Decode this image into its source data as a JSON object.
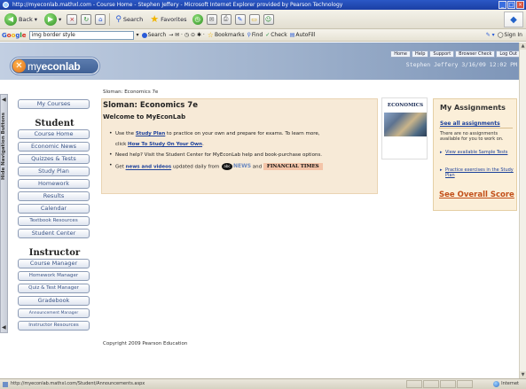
{
  "window": {
    "title": "http://myeconlab.mathxl.com - Course Home - Stephen Jeffery - Microsoft Internet Explorer provided by Pearson Technology"
  },
  "navbar": {
    "back_label": "Back",
    "search_label": "Search",
    "favorites_label": "Favorites"
  },
  "googlebar": {
    "logo": "Google",
    "search_value": "img border style",
    "search_label": "Search",
    "bookmarks_label": "Bookmarks",
    "find_label": "Find",
    "check_label": "Check",
    "autofill_label": "AutoFill",
    "signin_label": "Sign In"
  },
  "header": {
    "logo_my": "my",
    "logo_econlab": "econlab",
    "links": [
      "Home",
      "Help",
      "Support",
      "Browser Check",
      "Log Out"
    ],
    "user_line": "Stephen Jeffery 3/16/09 12:02 PM"
  },
  "hide_nav": {
    "label": "Hide Navigation Buttons"
  },
  "sidebar": {
    "my_courses": "My Courses",
    "student_heading": "Student",
    "student_items": [
      "Course Home",
      "Economic News",
      "Quizzes & Tests",
      "Study Plan",
      "Homework",
      "Results",
      "Calendar",
      "Textbook Resources",
      "Student Center"
    ],
    "instructor_heading": "Instructor",
    "instructor_items": [
      "Course Manager",
      "Homework Manager",
      "Quiz & Test Manager",
      "Gradebook",
      "Announcement Manager",
      "Instructor Resources"
    ]
  },
  "main": {
    "breadcrumb": "Sloman: Economics 7e",
    "course_title": "Sloman: Economics 7e",
    "welcome": "Welcome to MyEconLab",
    "line1_pre": "Use the ",
    "line1_link": "Study Plan",
    "line1_post": " to practice on your own and prepare for exams. To learn more,",
    "line1b_pre": "click ",
    "line1b_link": "How To Study On Your Own",
    "line1b_post": ".",
    "line2": "Need help? Visit the Student Center for MyEconLab help and book-purchase options.",
    "line3_pre": "Get ",
    "line3_link": "news and videos",
    "line3_mid": " updated daily from ",
    "abc_logo": "abc",
    "news_text": "NEWS",
    "line3_and": " and ",
    "ft_label": "FINANCIAL TIMES",
    "copyright": "Copyright 2009 Pearson Education"
  },
  "book": {
    "title": "ECONOMICS"
  },
  "assignments": {
    "title": "My Assignments",
    "see_all": "See all assignments",
    "none_text": "There are no assignments available for you to work on.",
    "link_samples": "View available Sample Tests",
    "link_studyplan": "Practice exercises in the Study Plan",
    "overall_score": "See Overall Score"
  },
  "statusbar": {
    "url": "http://myeconlab.mathxl.com/Student/Announcements.aspx",
    "zone": "Internet"
  },
  "colors": {
    "header_gradient_start": "#c2cfe2",
    "header_gradient_end": "#7d95b8",
    "main_panel": "#f7ead7",
    "assign_panel": "#fbefd9",
    "link": "#1a3f9a",
    "score_link": "#c24f18"
  }
}
